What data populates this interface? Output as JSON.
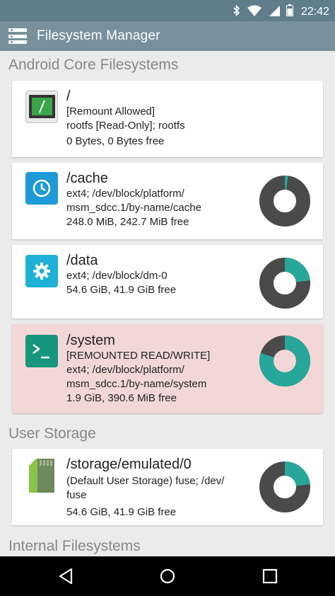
{
  "status_bar": {
    "time": "22:42",
    "icons": [
      "bluetooth-icon",
      "wifi-icon",
      "signal-icon",
      "battery-icon"
    ]
  },
  "app_bar": {
    "title": "Filesystem Manager",
    "menu_icon": "menu-icon"
  },
  "sections": {
    "core": "Android Core Filesystems",
    "user": "User Storage",
    "internal": "Internal Filesystems"
  },
  "filesystems": {
    "root": {
      "name": "/",
      "lines": [
        "[Remount Allowed]",
        "rootfs [Read-Only]; rootfs",
        "0 Bytes, 0 Bytes free"
      ],
      "icon": "terminal-icon"
    },
    "cache": {
      "name": "/cache",
      "lines": [
        "ext4; /dev/block/platform/",
        "msm_sdcc.1/by-name/cache",
        "248.0 MiB, 242.7 MiB free"
      ],
      "icon": "clock-icon",
      "used_fraction": 0.021
    },
    "data": {
      "name": "/data",
      "lines": [
        "ext4; /dev/block/dm-0",
        "54.6 GiB, 41.9 GiB free"
      ],
      "icon": "gear-icon",
      "used_fraction": 0.233
    },
    "system": {
      "name": "/system",
      "lines": [
        "[REMOUNTED READ/WRITE]",
        "ext4; /dev/block/platform/",
        "msm_sdcc.1/by-name/system",
        "1.9 GiB, 390.6 MiB free"
      ],
      "icon": "shell-icon",
      "used_fraction": 0.8
    },
    "storage": {
      "name": "/storage/emulated/0",
      "lines": [
        "(Default User Storage) fuse; /dev/",
        "fuse",
        "54.6 GiB, 41.9 GiB free"
      ],
      "icon": "sd-card-icon",
      "used_fraction": 0.233
    }
  },
  "colors": {
    "used": "#27a79a",
    "free": "#4a4a4a"
  },
  "nav": [
    "back-icon",
    "home-icon",
    "recents-icon"
  ]
}
